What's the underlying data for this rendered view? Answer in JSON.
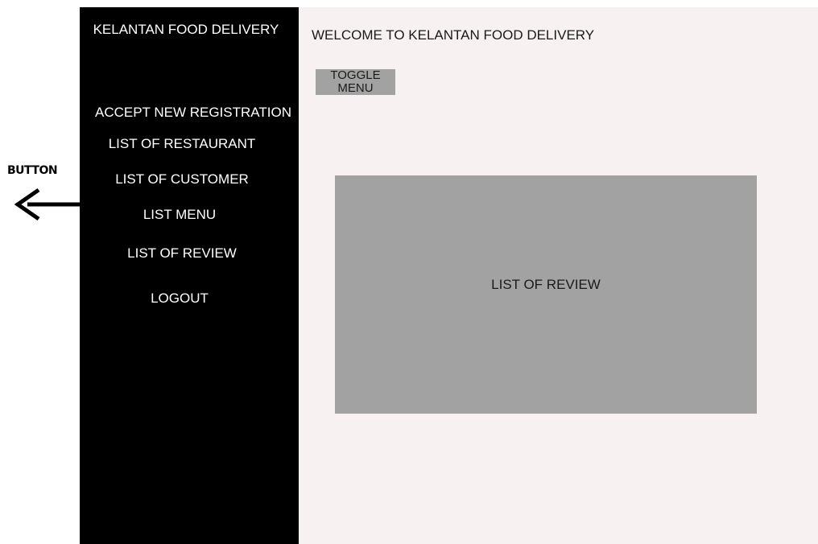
{
  "annotation": {
    "label": "BUTTON",
    "arrow_icon": "left-arrow-icon"
  },
  "sidebar": {
    "title": "KELANTAN FOOD DELIVERY",
    "items": [
      {
        "label": "ACCEPT NEW REGISTRATION"
      },
      {
        "label": "LIST OF RESTAURANT"
      },
      {
        "label": "LIST OF CUSTOMER"
      },
      {
        "label": "LIST MENU"
      },
      {
        "label": "LIST OF REVIEW"
      },
      {
        "label": "LOGOUT"
      }
    ]
  },
  "main": {
    "welcome": "WELCOME TO KELANTAN FOOD DELIVERY",
    "toggle_label": "TOGGLE MENU",
    "panel_label": "LIST OF REVIEW"
  },
  "colors": {
    "sidebar_bg": "#000000",
    "main_bg": "#f7f1f1",
    "panel_bg": "#a2a2a2"
  }
}
